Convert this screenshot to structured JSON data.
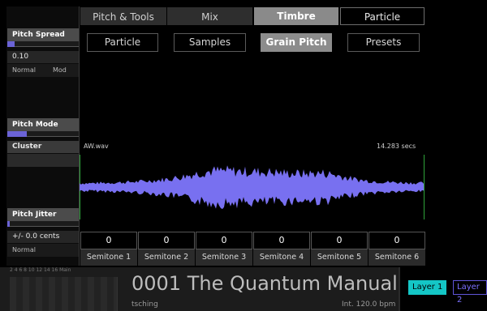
{
  "top_tabs": [
    {
      "label": "Pitch & Tools",
      "state": "normal"
    },
    {
      "label": "Mix",
      "state": "normal"
    },
    {
      "label": "Timbre",
      "state": "selected"
    },
    {
      "label": "Particle",
      "state": "outlined"
    }
  ],
  "sub_tabs": [
    {
      "label": "Particle",
      "selected": false
    },
    {
      "label": "Samples",
      "selected": false
    },
    {
      "label": "Grain Pitch",
      "selected": true
    },
    {
      "label": "Presets",
      "selected": false
    }
  ],
  "params": {
    "pitch_spread": {
      "label": "Pitch Spread",
      "value": "0.10",
      "level": 0.1,
      "opt_a": "Normal",
      "opt_b": "Mod"
    },
    "pitch_mode": {
      "label": "Pitch Mode",
      "value": "Cluster",
      "level": 0.27
    },
    "pitch_jitter": {
      "label": "Pitch Jitter",
      "value": "+/- 0.0 cents",
      "level": 0.02,
      "mode": "Normal"
    }
  },
  "sample": {
    "file": "AW.wav",
    "length": "14.283 secs"
  },
  "semitones": [
    {
      "label": "Semitone 1",
      "value": "0"
    },
    {
      "label": "Semitone 2",
      "value": "0"
    },
    {
      "label": "Semitone 3",
      "value": "0"
    },
    {
      "label": "Semitone 4",
      "value": "0"
    },
    {
      "label": "Semitone 5",
      "value": "0"
    },
    {
      "label": "Semitone 6",
      "value": "0"
    }
  ],
  "meter": {
    "scale": "2 4 6 8 10 12 14 16 Main"
  },
  "patch": {
    "title": "0001 The Quantum Manual",
    "author": "tsching",
    "tempo": "Int. 120.0 bpm"
  },
  "layers": [
    {
      "label": "Layer 1",
      "active": true
    },
    {
      "label": "Layer 2",
      "active": false
    }
  ],
  "colors": {
    "accent": "#6b63d6",
    "waveform": "#7870f0",
    "layer_active": "#14c6c6",
    "wave_marker": "#2fa33a"
  }
}
